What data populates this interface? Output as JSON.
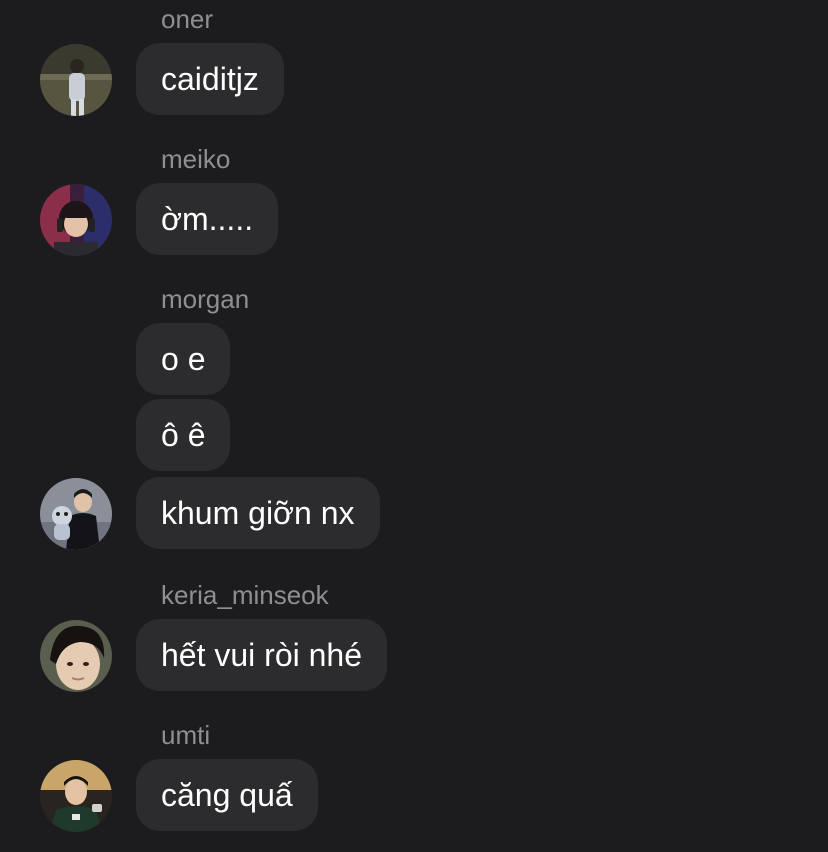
{
  "messages": [
    {
      "sender": "oner",
      "texts": [
        "caiditjz"
      ],
      "avatar": "oner-avatar"
    },
    {
      "sender": "meiko",
      "texts": [
        "ờm....."
      ],
      "avatar": "meiko-avatar"
    },
    {
      "sender": "morgan",
      "texts": [
        "o e",
        "ô ê",
        "khum giỡn nx"
      ],
      "avatar": "morgan-avatar"
    },
    {
      "sender": "keria_minseok",
      "texts": [
        "hết vui ròi nhé"
      ],
      "avatar": "keria-avatar"
    },
    {
      "sender": "umti",
      "texts": [
        "căng quấ"
      ],
      "avatar": "umti-avatar"
    }
  ],
  "colors": {
    "background": "#1c1c1e",
    "bubble": "#2c2c2e",
    "sender_text": "#8e8e93",
    "message_text": "#ffffff"
  }
}
